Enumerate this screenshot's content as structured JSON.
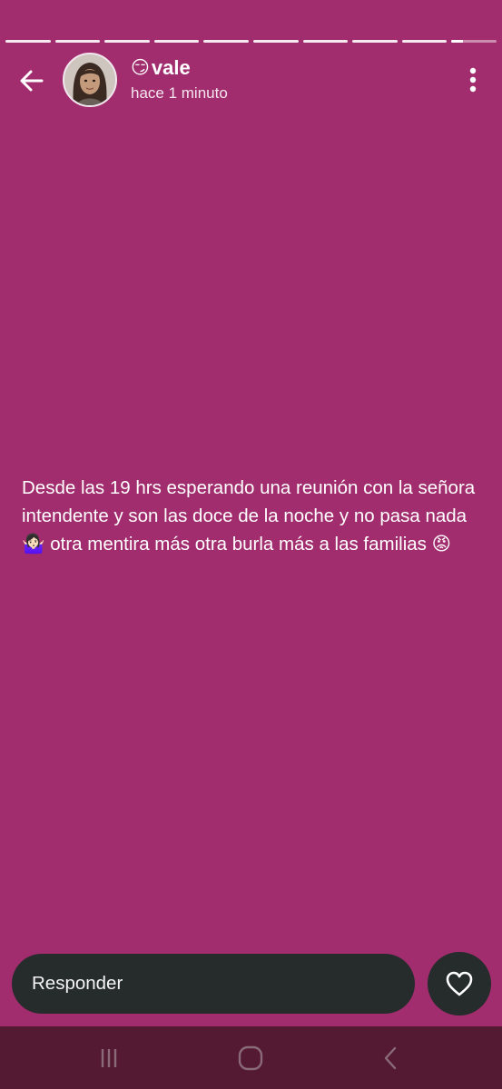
{
  "story": {
    "segments_total": 10,
    "current_segment_progress": 0.25,
    "user": {
      "status_emoji": "😏",
      "name": "vale",
      "posted": "hace 1 minuto"
    },
    "text": "Desde las 19 hrs esperando una reunión con la señora intendente y son las doce de la noche y no pasa nada 🤷🏻‍♀️ otra mentira más otra burla más a las familias 😡"
  },
  "reply": {
    "placeholder": "Responder"
  },
  "colors": {
    "background": "#a22d6e",
    "input_bg": "#262b2c",
    "navbar_bg": "#541a33"
  },
  "icons": {
    "back": "arrow-left-icon",
    "menu": "more-vertical-icon",
    "like": "heart-icon",
    "nav_recents": "recents-icon",
    "nav_home": "home-icon",
    "nav_back": "chevron-left-icon"
  }
}
